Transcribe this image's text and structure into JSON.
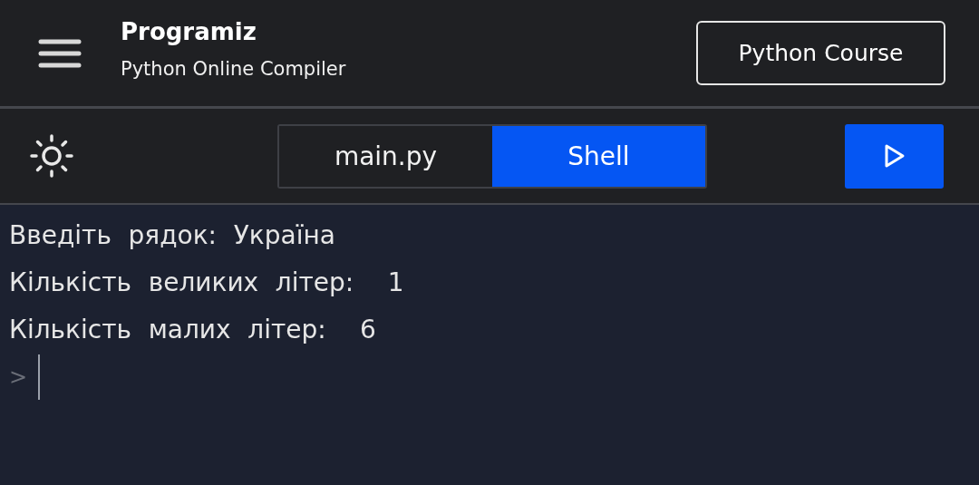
{
  "header": {
    "logo": "Programiz",
    "subtitle": "Python Online Compiler",
    "course_button": "Python Course"
  },
  "tabs": [
    {
      "label": "main.py",
      "selected": false
    },
    {
      "label": "Shell",
      "selected": true
    }
  ],
  "shell": {
    "lines": [
      "Введіть рядок: Україна",
      "Кількість великих літер:  1",
      "Кількість малих літер:  6"
    ],
    "prompt": ">"
  }
}
